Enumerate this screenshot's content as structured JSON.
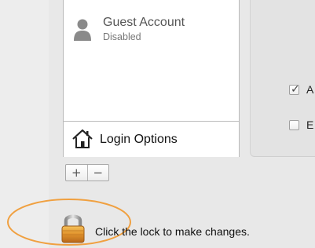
{
  "users_list": {
    "guest_account": {
      "name": "Guest Account",
      "status": "Disabled",
      "icon": "user-silhouette-icon"
    },
    "login_options": {
      "label": "Login Options",
      "icon": "house-icon"
    }
  },
  "account_controls": {
    "add_label": "+",
    "remove_label": "−"
  },
  "right_panel": {
    "checkbox_1": {
      "label": "A",
      "checked": true
    },
    "checkbox_2": {
      "label": "E",
      "checked": false
    }
  },
  "lock": {
    "message": "Click the lock to make changes.",
    "icon": "padlock-icon",
    "state": "locked"
  },
  "colors": {
    "annotation_ellipse": "#f0a040",
    "lock_gold": "#e0922c"
  }
}
